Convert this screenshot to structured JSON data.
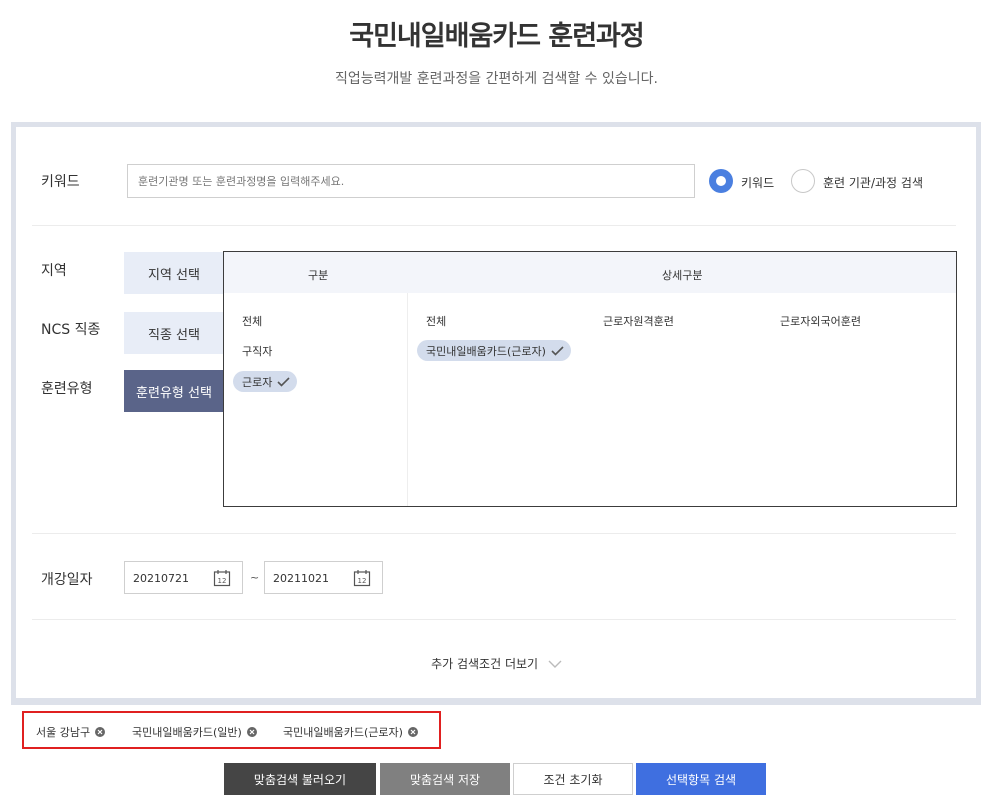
{
  "header": {
    "title": "국민내일배움카드 훈련과정",
    "subtitle": "직업능력개발 훈련과정을 간편하게 검색할 수 있습니다."
  },
  "keyword": {
    "label": "키워드",
    "placeholder": "훈련기관명 또는 훈련과정명을 입력해주세요.",
    "value": "",
    "radio_keyword": "키워드",
    "radio_institution": "훈련 기관/과정 검색",
    "selected": "키워드"
  },
  "filters": {
    "region_label": "지역",
    "ncs_label": "NCS 직종",
    "type_label": "훈련유형",
    "region_button": "지역 선택",
    "ncs_button": "직종 선택",
    "type_button": "훈련유형 선택"
  },
  "selector": {
    "col_category": "구분",
    "col_detail": "상세구분",
    "categories": [
      "전체",
      "구직자",
      "근로자"
    ],
    "selected_category": "근로자",
    "details": [
      "전체",
      "근로자원격훈련",
      "근로자외국어훈련",
      "국민내일배움카드(근로자)"
    ],
    "selected_detail": "국민내일배움카드(근로자)"
  },
  "dates": {
    "label": "개강일자",
    "start": "20210721",
    "end": "20211021",
    "separator": "~"
  },
  "more": {
    "label": "추가 검색조건 더보기"
  },
  "selected_tags": [
    "서울 강남구",
    "국민내일배움카드(일반)",
    "국민내일배움카드(근로자)"
  ],
  "buttons": {
    "load": "맞춤검색 불러오기",
    "save": "맞춤검색 저장",
    "reset": "조건 초기화",
    "search": "선택항목 검색"
  },
  "colors": {
    "accent_blue": "#3f6fe0",
    "radio_blue": "#4a7fe0",
    "active_tab": "#5a6489",
    "highlight_border": "#e02020"
  }
}
